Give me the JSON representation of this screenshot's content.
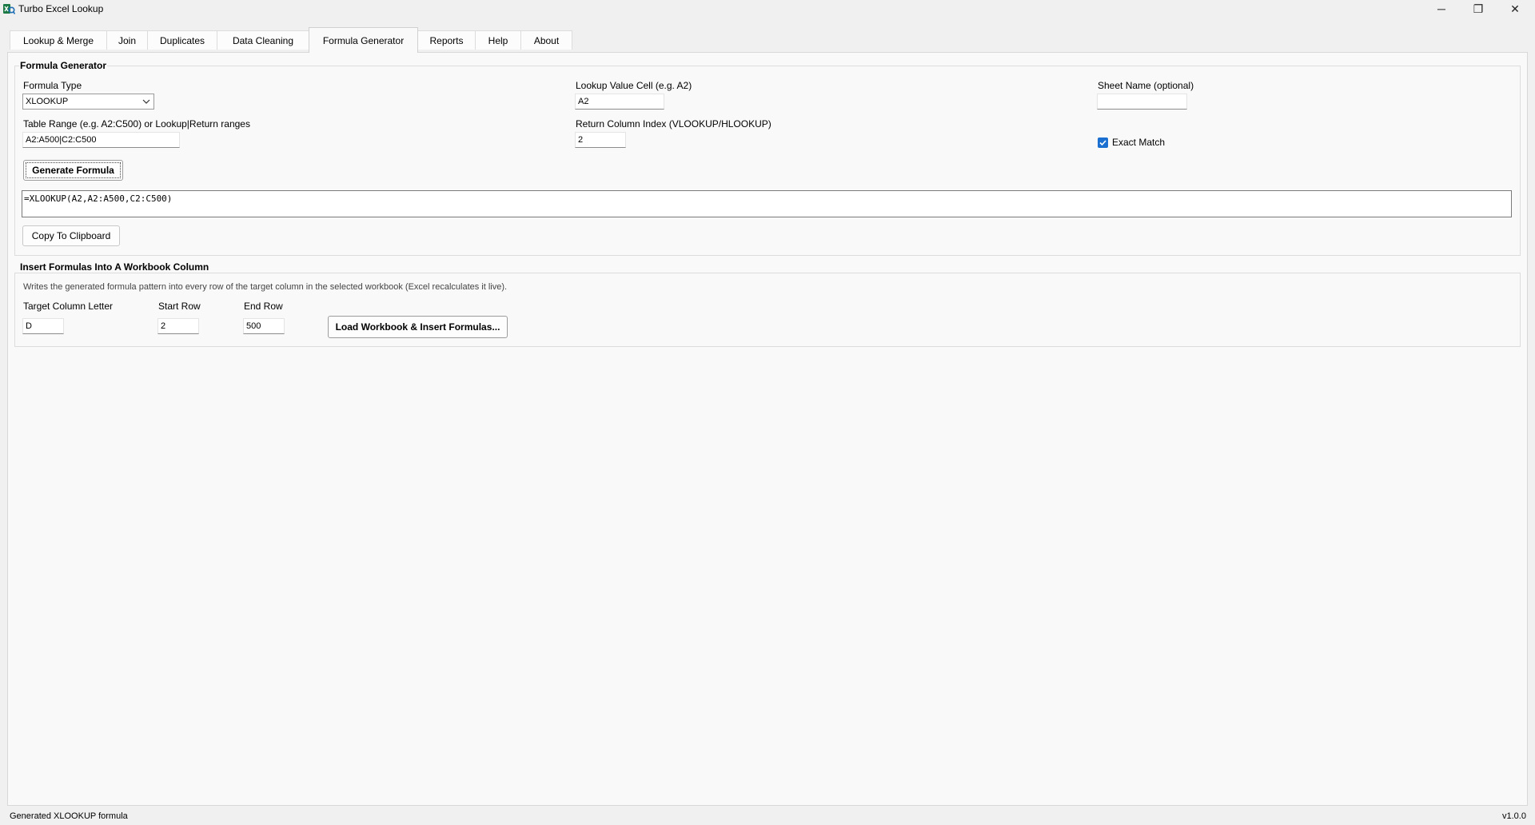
{
  "window": {
    "title": "Turbo Excel Lookup",
    "controls": {
      "minimize": "─",
      "maximize": "❐",
      "close": "✕"
    }
  },
  "tabs": [
    {
      "label": "Lookup & Merge"
    },
    {
      "label": "Join"
    },
    {
      "label": "Duplicates"
    },
    {
      "label": "Data Cleaning"
    },
    {
      "label": "Formula Generator",
      "active": true
    },
    {
      "label": "Reports"
    },
    {
      "label": "Help"
    },
    {
      "label": "About"
    }
  ],
  "formula_generator": {
    "group_title": "Formula Generator",
    "formula_type_label": "Formula Type",
    "formula_type_value": "XLOOKUP",
    "lookup_value_label": "Lookup Value Cell (e.g. A2)",
    "lookup_value": "A2",
    "sheet_name_label": "Sheet Name (optional)",
    "sheet_name_value": "",
    "table_range_label": "Table Range (e.g. A2:C500) or Lookup|Return ranges",
    "table_range_value": "A2:A500|C2:C500",
    "return_index_label": "Return Column Index (VLOOKUP/HLOOKUP)",
    "return_index_value": "2",
    "exact_match_label": "Exact Match",
    "exact_match_checked": true,
    "generate_button": "Generate Formula",
    "output_formula": "=XLOOKUP(A2,A2:A500,C2:C500)",
    "copy_button": "Copy To Clipboard"
  },
  "insert_formulas": {
    "group_title": "Insert Formulas Into A Workbook Column",
    "description": "Writes the generated formula pattern into every row of the target column in the selected workbook (Excel recalculates it live).",
    "target_column_label": "Target Column Letter",
    "target_column_value": "D",
    "start_row_label": "Start Row",
    "start_row_value": "2",
    "end_row_label": "End Row",
    "end_row_value": "500",
    "load_button": "Load Workbook & Insert Formulas..."
  },
  "status": {
    "message": "Generated XLOOKUP formula",
    "version": "v1.0.0"
  },
  "colors": {
    "accent": "#1a6fd0",
    "background": "#f0f0f0",
    "panel": "#f9f9f9"
  }
}
